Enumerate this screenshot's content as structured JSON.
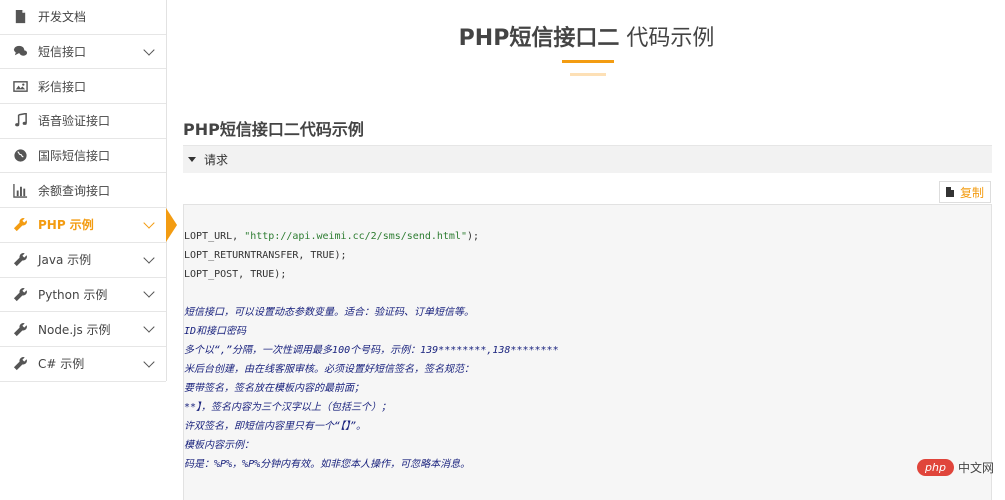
{
  "sidebar": {
    "items": [
      {
        "label": "开发文档",
        "icon": "document-icon",
        "has_chevron": false,
        "active": false
      },
      {
        "label": "短信接口",
        "icon": "chat-bubbles-icon",
        "has_chevron": true,
        "active": false
      },
      {
        "label": "彩信接口",
        "icon": "image-icon",
        "has_chevron": false,
        "active": false
      },
      {
        "label": "语音验证接口",
        "icon": "music-note-icon",
        "has_chevron": false,
        "active": false
      },
      {
        "label": "国际短信接口",
        "icon": "globe-icon",
        "has_chevron": false,
        "active": false
      },
      {
        "label": "余额查询接口",
        "icon": "bar-chart-icon",
        "has_chevron": false,
        "active": false
      },
      {
        "label": "PHP 示例",
        "icon": "wrench-icon",
        "has_chevron": true,
        "active": true
      },
      {
        "label": "Java 示例",
        "icon": "wrench-icon",
        "has_chevron": true,
        "active": false
      },
      {
        "label": "Python 示例",
        "icon": "wrench-icon",
        "has_chevron": true,
        "active": false
      },
      {
        "label": "Node.js 示例",
        "icon": "wrench-icon",
        "has_chevron": true,
        "active": false
      },
      {
        "label": "C# 示例",
        "icon": "wrench-icon",
        "has_chevron": true,
        "active": false
      }
    ]
  },
  "header": {
    "title_strong": "PHP短信接口二",
    "title_rest": " 代码示例",
    "accent_color": "#f39c12"
  },
  "section": {
    "title": "PHP短信接口二代码示例",
    "request_label": "请求"
  },
  "code": {
    "copy_label": "复制",
    "lines": [
      {
        "type": "code",
        "pre": "LOPT_URL, ",
        "str": "\"http://api.weimi.cc/2/sms/send.html\"",
        "post": ");"
      },
      {
        "type": "code",
        "pre": "LOPT_RETURNTRANSFER, TRUE);",
        "str": "",
        "post": ""
      },
      {
        "type": "code",
        "pre": "LOPT_POST, TRUE);",
        "str": "",
        "post": ""
      },
      {
        "type": "blank",
        "pre": "",
        "str": "",
        "post": ""
      },
      {
        "type": "comment",
        "pre": "短信接口，可以设置动态参数变量。适合：验证码、订单短信等。",
        "str": "",
        "post": ""
      },
      {
        "type": "comment",
        "pre": "ID和接口密码",
        "str": "",
        "post": ""
      },
      {
        "type": "comment",
        "pre": "多个以“,”分隔，一次性调用最多100个号码，示例：139********,138********",
        "str": "",
        "post": ""
      },
      {
        "type": "comment",
        "pre": "米后台创建，由在线客服审核。必须设置好短信签名，签名规范：",
        "str": "",
        "post": ""
      },
      {
        "type": "comment",
        "pre": "要带签名，签名放在模板内容的最前面；",
        "str": "",
        "post": ""
      },
      {
        "type": "comment",
        "pre": "**】，签名内容为三个汉字以上（包括三个）；",
        "str": "",
        "post": ""
      },
      {
        "type": "comment",
        "pre": "许双签名，即短信内容里只有一个“【】”。",
        "str": "",
        "post": ""
      },
      {
        "type": "comment",
        "pre": "模板内容示例：",
        "str": "",
        "post": ""
      },
      {
        "type": "comment",
        "pre": "码是：%P%，%P%分钟内有效。如非您本人操作，可忽略本消息。",
        "str": "",
        "post": ""
      }
    ]
  },
  "watermark": {
    "pill": "php",
    "text": "中文网"
  }
}
